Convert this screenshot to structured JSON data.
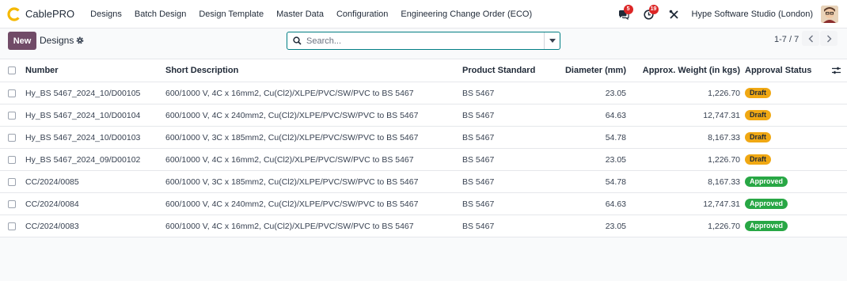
{
  "navbar": {
    "app_name": "CablePRO",
    "menu": [
      "Designs",
      "Batch Design",
      "Design Template",
      "Master Data",
      "Configuration",
      "Engineering Change Order (ECO)"
    ],
    "messages_count": "5",
    "activities_count": "19",
    "company": "Hype Software Studio (London)"
  },
  "control": {
    "new_label": "New",
    "title": "Designs",
    "search_placeholder": "Search...",
    "pager": "1-7 / 7"
  },
  "table": {
    "columns": [
      "Number",
      "Short Description",
      "Product Standard",
      "Diameter (mm)",
      "Approx. Weight (in kgs)",
      "Approval Status"
    ],
    "rows": [
      {
        "number": "Hy_BS 5467_2024_10/D00105",
        "description": "600/1000 V, 4C x 16mm2, Cu(Cl2)/XLPE/PVC/SW/PVC to BS 5467",
        "standard": "BS 5467",
        "diameter": "23.05",
        "weight": "1,226.70",
        "status": "Draft"
      },
      {
        "number": "Hy_BS 5467_2024_10/D00104",
        "description": "600/1000 V, 4C x 240mm2, Cu(Cl2)/XLPE/PVC/SW/PVC to BS 5467",
        "standard": "BS 5467",
        "diameter": "64.63",
        "weight": "12,747.31",
        "status": "Draft"
      },
      {
        "number": "Hy_BS 5467_2024_10/D00103",
        "description": "600/1000 V, 3C x 185mm2, Cu(Cl2)/XLPE/PVC/SW/PVC to BS 5467",
        "standard": "BS 5467",
        "diameter": "54.78",
        "weight": "8,167.33",
        "status": "Draft"
      },
      {
        "number": "Hy_BS 5467_2024_09/D00102",
        "description": "600/1000 V, 4C x 16mm2, Cu(Cl2)/XLPE/PVC/SW/PVC to BS 5467",
        "standard": "BS 5467",
        "diameter": "23.05",
        "weight": "1,226.70",
        "status": "Draft"
      },
      {
        "number": "CC/2024/0085",
        "description": "600/1000 V, 3C x 185mm2, Cu(Cl2)/XLPE/PVC/SW/PVC to BS 5467",
        "standard": "BS 5467",
        "diameter": "54.78",
        "weight": "8,167.33",
        "status": "Approved"
      },
      {
        "number": "CC/2024/0084",
        "description": "600/1000 V, 4C x 240mm2, Cu(Cl2)/XLPE/PVC/SW/PVC to BS 5467",
        "standard": "BS 5467",
        "diameter": "64.63",
        "weight": "12,747.31",
        "status": "Approved"
      },
      {
        "number": "CC/2024/0083",
        "description": "600/1000 V, 4C x 16mm2, Cu(Cl2)/XLPE/PVC/SW/PVC to BS 5467",
        "standard": "BS 5467",
        "diameter": "23.05",
        "weight": "1,226.70",
        "status": "Approved"
      }
    ]
  },
  "colors": {
    "brand": "#714b67",
    "accent": "#017e84",
    "draft": "#f0a813",
    "approved": "#28a745",
    "counter": "#dc2626"
  },
  "icons": {
    "logo": "cablepro-logo-icon",
    "messages": "chat-icon",
    "activities": "clock-icon",
    "debug": "tools-icon",
    "settings": "gear-icon",
    "search": "search-icon",
    "dropdown": "caret-down-icon",
    "prev": "chevron-left-icon",
    "next": "chevron-right-icon",
    "optional_columns": "sliders-icon"
  }
}
